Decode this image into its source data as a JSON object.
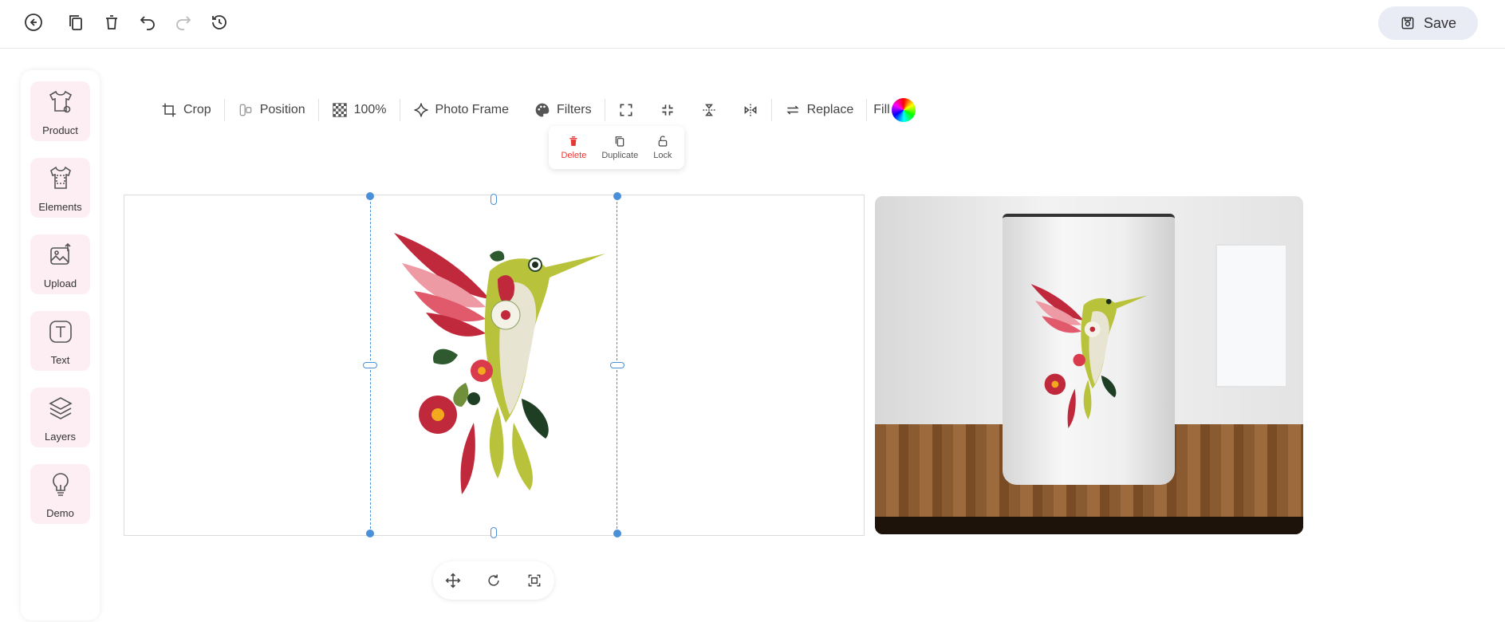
{
  "toolbar_top": {
    "save_label": "Save"
  },
  "sidebar": {
    "items": [
      {
        "label": "Product",
        "icon": "tshirt-icon"
      },
      {
        "label": "Elements",
        "icon": "elements-icon"
      },
      {
        "label": "Upload",
        "icon": "upload-image-icon"
      },
      {
        "label": "Text",
        "icon": "text-icon"
      },
      {
        "label": "Layers",
        "icon": "layers-icon"
      },
      {
        "label": "Demo",
        "icon": "lightbulb-icon"
      }
    ]
  },
  "edit_toolbar": {
    "crop": "Crop",
    "position": "Position",
    "opacity": "100%",
    "photo_frame": "Photo Frame",
    "filters": "Filters",
    "replace": "Replace",
    "fill": "Fill"
  },
  "context_menu": {
    "delete": "Delete",
    "duplicate": "Duplicate",
    "lock": "Lock"
  },
  "colors": {
    "accent": "#4a90d9",
    "sidebar_bg": "#fdeef3",
    "delete": "#e53935",
    "save_bg": "#e9ebf5"
  }
}
